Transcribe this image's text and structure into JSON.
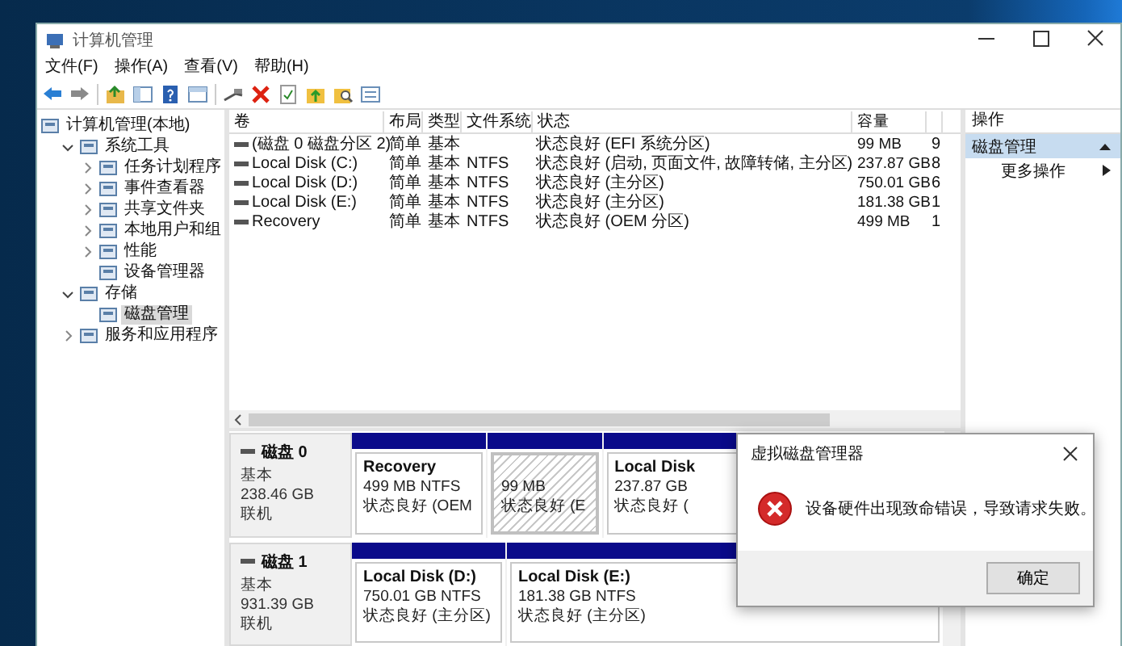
{
  "window": {
    "title": "计算机管理"
  },
  "menu": [
    "文件(F)",
    "操作(A)",
    "查看(V)",
    "帮助(H)"
  ],
  "tree": [
    {
      "label": "计算机管理(本地)",
      "selected": false,
      "children": [
        {
          "label": "系统工具",
          "expanded": true,
          "selected": false,
          "children": [
            {
              "label": "任务计划程序",
              "expanded": false,
              "selected": false
            },
            {
              "label": "事件查看器",
              "expanded": false,
              "selected": false
            },
            {
              "label": "共享文件夹",
              "expanded": false,
              "selected": false
            },
            {
              "label": "本地用户和组",
              "expanded": false,
              "selected": false
            },
            {
              "label": "性能",
              "expanded": false,
              "selected": false
            },
            {
              "label": "设备管理器",
              "selected": false
            }
          ]
        },
        {
          "label": "存储",
          "expanded": true,
          "selected": false,
          "children": [
            {
              "label": "磁盘管理",
              "selected": true
            }
          ]
        },
        {
          "label": "服务和应用程序",
          "expanded": false,
          "selected": false
        }
      ]
    }
  ],
  "table": {
    "columns": [
      "卷",
      "布局",
      "类型",
      "文件系统",
      "状态",
      "容量",
      null
    ],
    "rows": [
      [
        "(磁盘 0 磁盘分区 2)",
        "简单",
        "基本",
        null,
        "状态良好 (EFI 系统分区)",
        "99 MB",
        "9"
      ],
      [
        "Local Disk (C:)",
        "简单",
        "基本",
        "NTFS",
        "状态良好 (启动, 页面文件, 故障转储, 主分区)",
        "237.87 GB",
        "8"
      ],
      [
        "Local Disk (D:)",
        "简单",
        "基本",
        "NTFS",
        "状态良好 (主分区)",
        "750.01 GB",
        "6"
      ],
      [
        "Local Disk (E:)",
        "简单",
        "基本",
        "NTFS",
        "状态良好 (主分区)",
        "181.38 GB",
        "1"
      ],
      [
        "Recovery",
        "简单",
        "基本",
        "NTFS",
        "状态良好 (OEM 分区)",
        "499 MB",
        "1"
      ]
    ]
  },
  "disks": [
    {
      "name": "磁盘 0",
      "type": "基本",
      "size": "238.46 GB",
      "status": "联机",
      "partitions": [
        {
          "kind": "primary",
          "name": "Recovery",
          "size": "499 MB NTFS",
          "status": "状态良好 (OEM"
        },
        {
          "kind": "hatched",
          "size": "99 MB",
          "status": "状态良好 (E"
        },
        {
          "kind": "primary",
          "name": "Local Disk",
          "size": "237.87 GB",
          "status": "状态良好 ("
        }
      ]
    },
    {
      "name": "磁盘 1",
      "type": "基本",
      "size": "931.39 GB",
      "status": "联机",
      "partitions": [
        {
          "kind": "primary",
          "name": "Local Disk  (D:)",
          "size": "750.01 GB NTFS",
          "status": "状态良好 (主分区)"
        },
        {
          "kind": "primary",
          "name": "Local Disk (E:)",
          "size": "181.38 GB NTFS",
          "status": "状态良好 (主分区)"
        }
      ]
    }
  ],
  "actions": {
    "title": "操作",
    "items": [
      {
        "kind": "header",
        "label": "磁盘管理"
      },
      {
        "kind": "submenu",
        "label": "更多操作"
      }
    ]
  },
  "dialog": {
    "title": "虚拟磁盘管理器",
    "message": "设备硬件出现致命错误，导致请求失败。",
    "button": "确定"
  }
}
